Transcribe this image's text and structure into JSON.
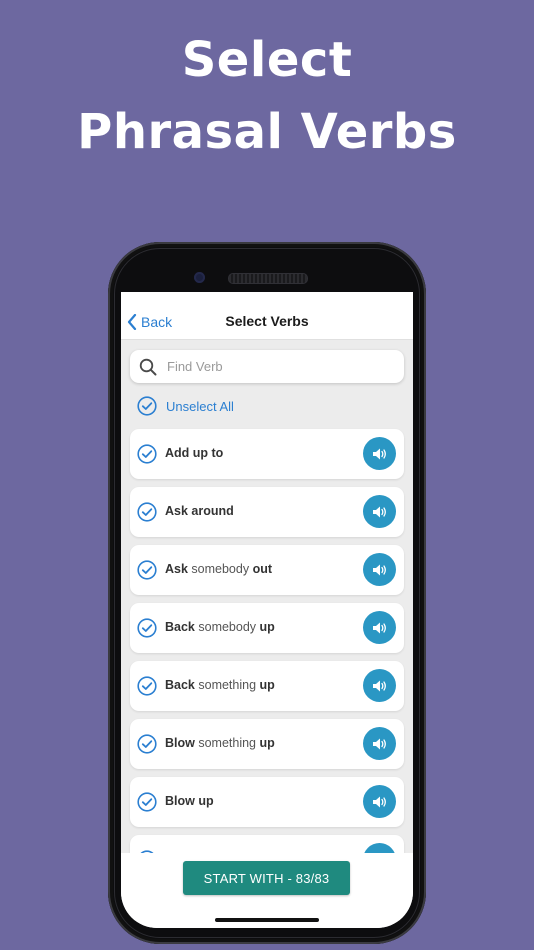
{
  "promo": {
    "line1": "Select",
    "line2": "Phrasal Verbs"
  },
  "nav": {
    "back_label": "Back",
    "title": "Select Verbs"
  },
  "search": {
    "placeholder": "Find Verb",
    "value": ""
  },
  "unselect_all_label": "Unselect All",
  "verbs": [
    {
      "bold1": "Add up to",
      "plain": "",
      "bold2": ""
    },
    {
      "bold1": "Ask around",
      "plain": "",
      "bold2": ""
    },
    {
      "bold1": "Ask",
      "plain": " somebody ",
      "bold2": "out"
    },
    {
      "bold1": "Back",
      "plain": " somebody ",
      "bold2": "up"
    },
    {
      "bold1": "Back",
      "plain": " something ",
      "bold2": "up"
    },
    {
      "bold1": "Blow",
      "plain": " something ",
      "bold2": "up"
    },
    {
      "bold1": "Blow up",
      "plain": "",
      "bold2": ""
    },
    {
      "bold1": "",
      "plain": "",
      "bold2": ""
    }
  ],
  "start_button_label": "START WITH - 83/83",
  "colors": {
    "background": "#6d68a0",
    "accent_blue": "#2b7fd1",
    "audio_button": "#2a97c4",
    "start_button": "#1f8a7f"
  },
  "icons": {
    "back": "chevron-left-icon",
    "search": "search-icon",
    "check": "check-circle-icon",
    "audio": "speaker-icon"
  }
}
